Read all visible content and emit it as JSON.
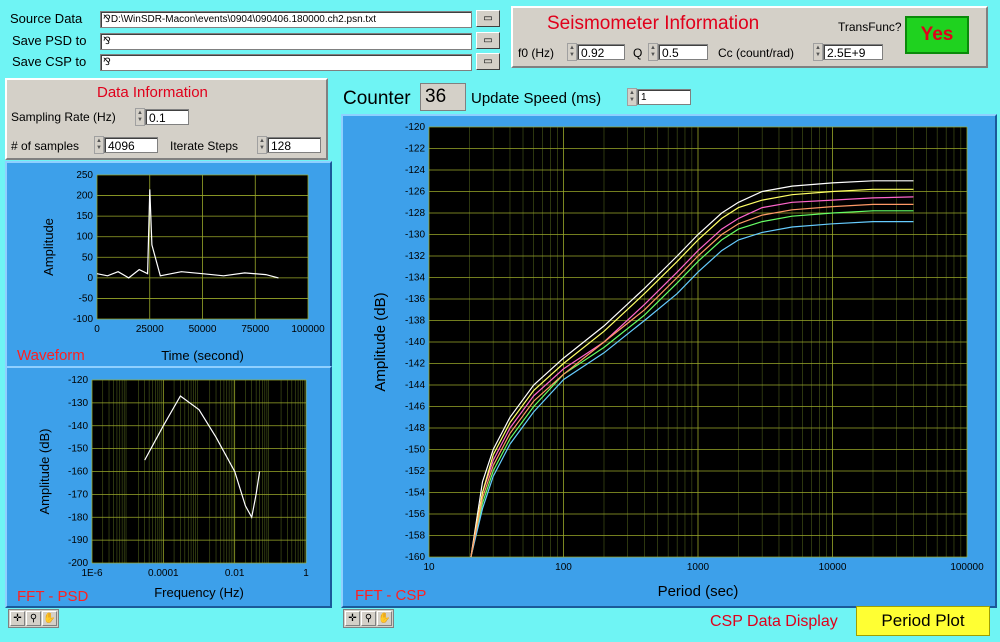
{
  "files": {
    "source_label": "Source Data",
    "source_value": "D:\\WinSDR-Macon\\events\\0904\\090406.180000.ch2.psn.txt",
    "psd_label": "Save PSD to",
    "psd_value": "",
    "csp_label": "Save CSP to",
    "csp_value": ""
  },
  "seismometer": {
    "title": "Seismometer Information",
    "transfunc_label": "TransFunc?",
    "transfunc_button": "Yes",
    "f0_label": "f0 (Hz)",
    "f0_value": "0.92",
    "q_label": "Q",
    "q_value": "0.5",
    "cc_label": "Cc (count/rad)",
    "cc_value": "2.5E+9"
  },
  "data_info": {
    "title": "Data Information",
    "sampling_label": "Sampling Rate (Hz)",
    "sampling_value": "0.1",
    "samples_label": "# of samples",
    "samples_value": "4096",
    "iterate_label": "Iterate Steps",
    "iterate_value": "128"
  },
  "counter": {
    "label": "Counter",
    "value": "36",
    "speed_label": "Update Speed (ms)",
    "speed_value": "1"
  },
  "csp_display": {
    "label": "CSP Data Display",
    "button": "Period Plot"
  },
  "colors": {
    "background": "#6ff4f4",
    "panel": "#d4d0c8",
    "chart_frame": "#3da0ea",
    "plot_bg": "#000000",
    "grid": "#7f8f2a",
    "title_red": "#e0001b",
    "yes_button": "#1fd21f",
    "period_button": "#ffff33"
  },
  "chart_data": [
    {
      "type": "line",
      "label": "Waveform",
      "xlabel": "Time (second)",
      "ylabel": "Amplitude",
      "xlim": [
        0,
        100000
      ],
      "ylim": [
        -100,
        250
      ],
      "x_ticks": [
        "0",
        "25000",
        "50000",
        "75000",
        "100000"
      ],
      "y_ticks": [
        "250",
        "200",
        "150",
        "100",
        "50",
        "0",
        "-50",
        "-100"
      ],
      "series": [
        {
          "x": [
            0,
            5000,
            10000,
            15000,
            20000,
            24000,
            25000,
            26000,
            30000,
            40000,
            50000,
            60000,
            70000,
            80000,
            86000
          ],
          "y": [
            10,
            5,
            15,
            0,
            20,
            10,
            215,
            80,
            5,
            15,
            10,
            5,
            12,
            8,
            0
          ],
          "color": "#ffffff"
        }
      ]
    },
    {
      "type": "line",
      "label": "FFT - PSD",
      "xlabel": "Frequency (Hz)",
      "ylabel": "Amplitude (dB)",
      "xscale": "log",
      "xlim": [
        1e-06,
        1
      ],
      "ylim": [
        -200,
        -120
      ],
      "x_ticks": [
        "1E-6",
        "0.0001",
        "0.01",
        "1"
      ],
      "y_ticks": [
        "-120",
        "-130",
        "-140",
        "-150",
        "-160",
        "-170",
        "-180",
        "-190",
        "-200"
      ],
      "series": [
        {
          "x": [
            3e-05,
            0.0001,
            0.0003,
            0.001,
            0.003,
            0.01,
            0.02,
            0.03,
            0.04,
            0.05
          ],
          "y": [
            -155,
            -140,
            -127,
            -133,
            -145,
            -160,
            -175,
            -180,
            -170,
            -160
          ],
          "color": "#ffffff"
        }
      ]
    },
    {
      "type": "line",
      "label": "FFT - CSP",
      "xlabel": "Period (sec)",
      "ylabel": "Amplitude (dB)",
      "xscale": "log",
      "xlim": [
        10,
        100000
      ],
      "ylim": [
        -160,
        -120
      ],
      "x_ticks": [
        "10",
        "100",
        "1000",
        "10000",
        "100000"
      ],
      "y_ticks": [
        "-120",
        "-122",
        "-124",
        "-126",
        "-128",
        "-130",
        "-132",
        "-134",
        "-136",
        "-138",
        "-140",
        "-142",
        "-144",
        "-146",
        "-148",
        "-150",
        "-152",
        "-154",
        "-156",
        "-158",
        "-160"
      ],
      "series": [
        {
          "x": [
            20.5,
            25,
            30,
            40,
            60,
            100,
            200,
            400,
            700,
            1000,
            1500,
            2000,
            3000,
            5000,
            10000,
            20000,
            40000
          ],
          "y": [
            -160,
            -153,
            -150,
            -147,
            -144,
            -141.5,
            -138.5,
            -135,
            -132,
            -130,
            -128,
            -127,
            -126,
            -125.5,
            -125.2,
            -125,
            -125
          ],
          "color": "#ffffff"
        },
        {
          "x": [
            20.5,
            25,
            30,
            40,
            60,
            100,
            200,
            400,
            700,
            1000,
            1500,
            2000,
            3000,
            5000,
            10000,
            20000,
            40000
          ],
          "y": [
            -160,
            -154,
            -151,
            -148,
            -145,
            -142.5,
            -140,
            -136.5,
            -133.5,
            -131.5,
            -129.5,
            -128.5,
            -127.5,
            -127,
            -126.8,
            -126.6,
            -126.5
          ],
          "color": "#ff66cc"
        },
        {
          "x": [
            20.5,
            25,
            30,
            40,
            60,
            100,
            200,
            400,
            700,
            1000,
            1500,
            2000,
            3000,
            5000,
            10000,
            20000,
            40000
          ],
          "y": [
            -160,
            -155,
            -152,
            -149,
            -146,
            -143,
            -140.5,
            -137.5,
            -134.5,
            -132.5,
            -130.5,
            -129.5,
            -128.8,
            -128.3,
            -128,
            -127.8,
            -127.8
          ],
          "color": "#66ff66"
        },
        {
          "x": [
            20.5,
            25,
            30,
            40,
            60,
            100,
            200,
            400,
            700,
            1000,
            1500,
            2000,
            3000,
            5000,
            10000,
            20000,
            40000
          ],
          "y": [
            -160,
            -155.5,
            -152.5,
            -149.5,
            -146.5,
            -143.5,
            -141,
            -138,
            -135.5,
            -133.5,
            -131.5,
            -130.5,
            -129.8,
            -129.3,
            -129,
            -128.8,
            -128.8
          ],
          "color": "#66ccff"
        },
        {
          "x": [
            20.5,
            25,
            30,
            40,
            60,
            100,
            200,
            400,
            700,
            1000,
            1500,
            2000,
            3000,
            5000,
            10000,
            20000,
            40000
          ],
          "y": [
            -160,
            -154,
            -150.5,
            -147.5,
            -144.5,
            -142,
            -139,
            -135.5,
            -132.5,
            -130.5,
            -128.5,
            -127.5,
            -126.8,
            -126.3,
            -126,
            -125.8,
            -125.8
          ],
          "color": "#ffff66"
        },
        {
          "x": [
            20.5,
            25,
            30,
            40,
            60,
            100,
            200,
            400,
            700,
            1000,
            1500,
            2000,
            3000,
            5000,
            10000,
            20000,
            40000
          ],
          "y": [
            -160,
            -154.5,
            -151.5,
            -148.5,
            -145.5,
            -143,
            -140,
            -137,
            -134,
            -132,
            -130,
            -129,
            -128.2,
            -127.7,
            -127.4,
            -127.2,
            -127.2
          ],
          "color": "#ff9966"
        }
      ]
    }
  ]
}
